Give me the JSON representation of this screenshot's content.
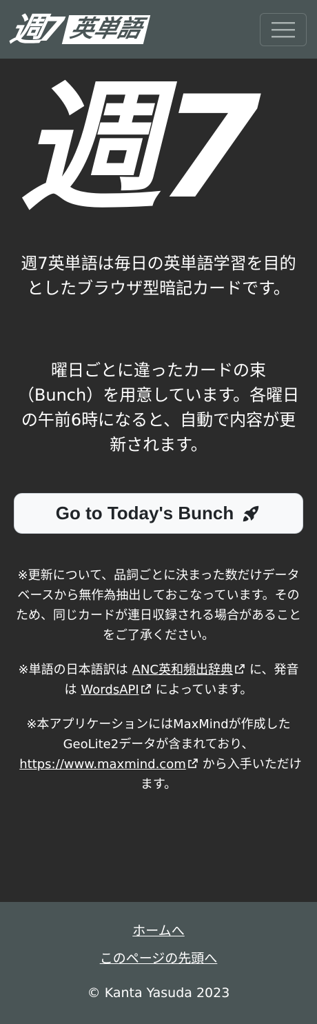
{
  "navbar": {
    "brand_mark": "週7",
    "brand_word": "英単語",
    "menu_icon": "hamburger-menu-icon"
  },
  "hero": {
    "logo_text": "週7"
  },
  "intro": {
    "paragraph1": "週7英単語は毎日の英単語学習を目的としたブラウザ型暗記カードです。",
    "paragraph2": "曜日ごとに違ったカードの束（Bunch）を用意しています。各曜日の午前6時になると、自動で内容が更新されます。"
  },
  "cta": {
    "label": "Go to Today's Bunch",
    "icon": "rocket-icon"
  },
  "notes": {
    "note1": "※更新について、品詞ごとに決まった数だけデータベースから無作為抽出しておこなっています。そのため、同じカードが連日収録される場合があることをご了承ください。",
    "note2_prefix": "※単語の日本語訳は",
    "note2_link1": "ANC英和頻出辞典",
    "note2_mid": "に、発音は",
    "note2_link2": "WordsAPI",
    "note2_suffix": "によっています。",
    "note3_prefix": "※本アプリケーションにはMaxMindが作成したGeoLite2データが含まれており、",
    "note3_link": "https://www.maxmind.com",
    "note3_suffix": "から入手いただけます。"
  },
  "footer": {
    "home_link": "ホームへ",
    "top_link": "このページの先頭へ",
    "copyright": "© Kanta Yasuda 2023"
  },
  "colors": {
    "navbar_bg": "#4a5556",
    "page_bg": "#2b2b2b",
    "button_bg": "#f8f9fa"
  }
}
